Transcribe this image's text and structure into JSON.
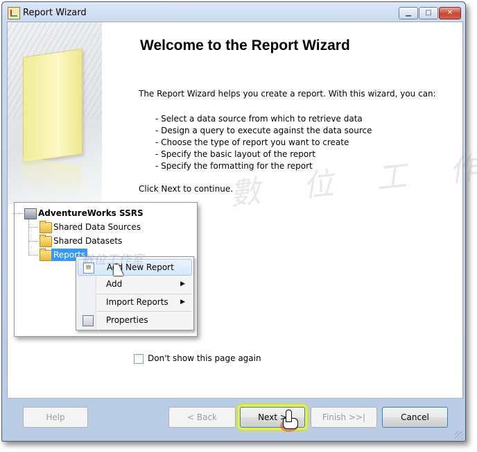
{
  "window": {
    "title": "Report Wizard",
    "controls": {
      "minimize_glyph": "▁",
      "maximize_glyph": "□",
      "close_glyph": "✕"
    }
  },
  "main": {
    "heading": "Welcome to the Report Wizard",
    "intro": "The Report Wizard helps you create a report. With this wizard, you can:",
    "bullets": [
      "- Select a data source from which to retrieve data",
      "- Design a query to execute against the data source",
      "- Choose the type of report you want to create",
      "- Specify the basic layout of the report",
      "- Specify the formatting for the report"
    ],
    "continue_text": "Click Next to continue."
  },
  "solution_explorer": {
    "root": "AdventureWorks SSRS",
    "items": [
      "Shared Data Sources",
      "Shared Datasets",
      "Reports"
    ],
    "selected": "Reports"
  },
  "context_menu": {
    "items": [
      {
        "label": "Add New Report",
        "icon": "report-icon",
        "submenu": false
      },
      {
        "label": "Add",
        "icon": "",
        "submenu": true
      },
      {
        "label": "Import Reports",
        "icon": "",
        "submenu": true
      },
      {
        "label": "Properties",
        "icon": "properties-icon",
        "submenu": false
      }
    ],
    "arrow_glyph": "▶"
  },
  "options": {
    "dont_show_label": "Don't show this page again",
    "dont_show_checked": false
  },
  "buttons": {
    "help": "Help",
    "back": "< Back",
    "next": "Next >",
    "finish": "Finish >>|",
    "cancel": "Cancel"
  },
  "colors": {
    "selection": "#3399ff",
    "next_highlight": "#e8f23a"
  }
}
